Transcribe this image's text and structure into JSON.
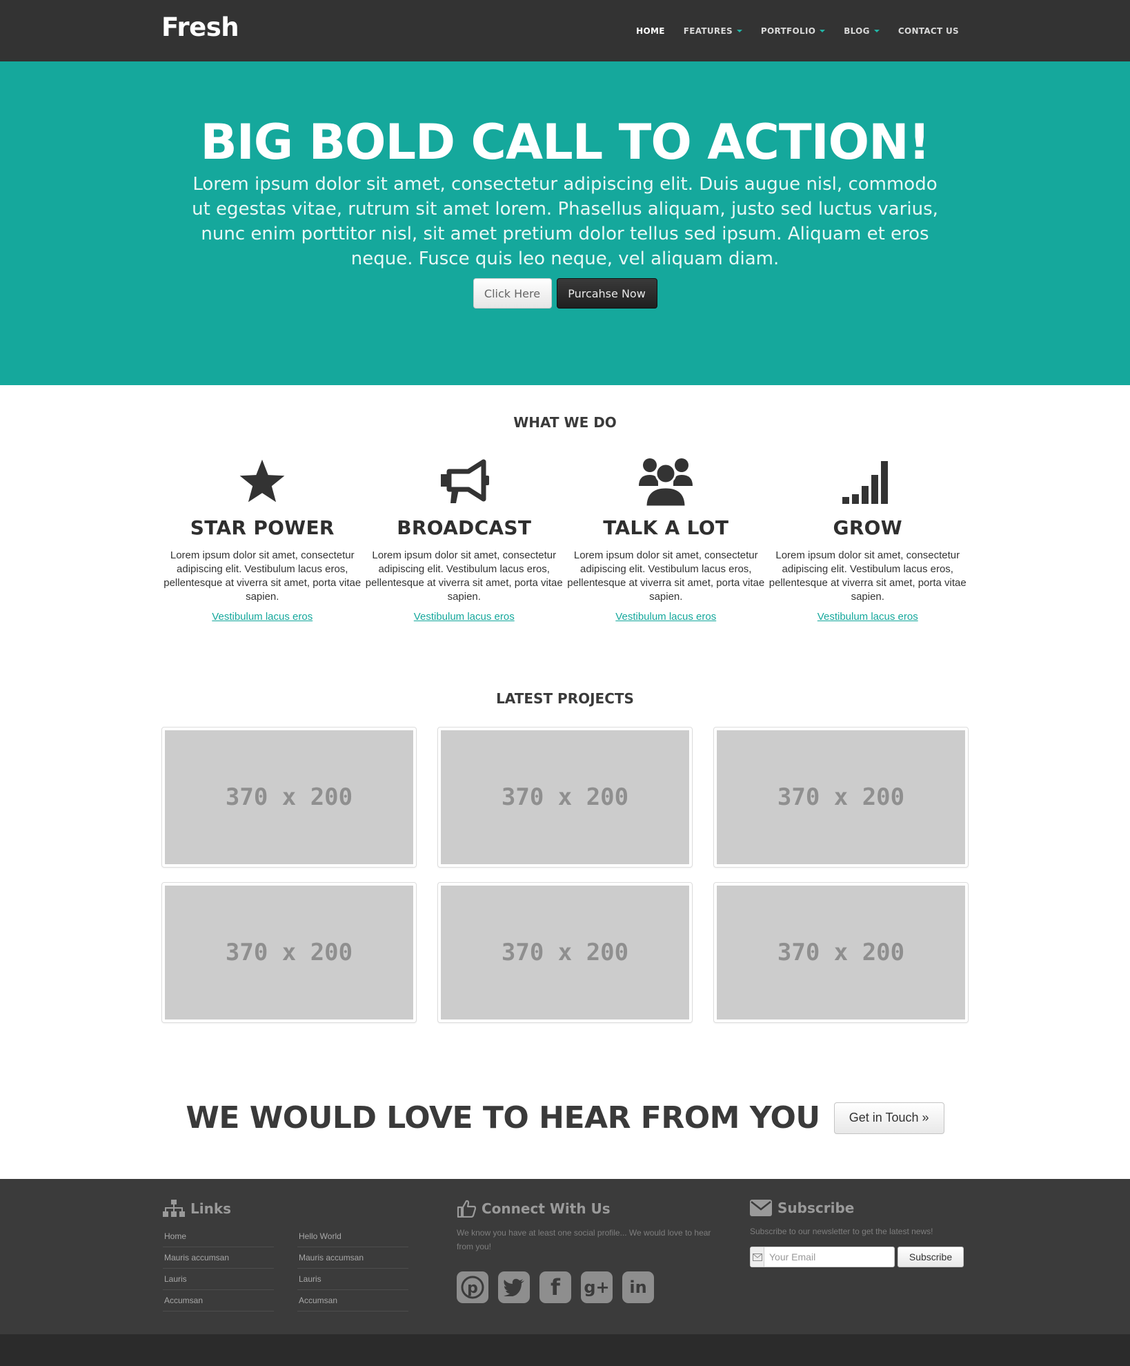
{
  "navbar": {
    "brand": "Fresh",
    "items": [
      {
        "label": "HOME",
        "active": true,
        "dropdown": false
      },
      {
        "label": "FEATURES",
        "active": false,
        "dropdown": true
      },
      {
        "label": "PORTFOLIO",
        "active": false,
        "dropdown": true
      },
      {
        "label": "BLOG",
        "active": false,
        "dropdown": true
      },
      {
        "label": "CONTACT US",
        "active": false,
        "dropdown": false
      }
    ]
  },
  "hero": {
    "title": "BIG BOLD CALL TO ACTION!",
    "text": "Lorem ipsum dolor sit amet, consectetur adipiscing elit. Duis augue nisl, commodo ut egestas vitae, rutrum sit amet lorem. Phasellus aliquam, justo sed luctus varius, nunc enim porttitor nisl, sit amet pretium dolor tellus sed ipsum. Aliquam et eros neque. Fusce quis leo neque, vel aliquam diam.",
    "button_primary": "Click Here",
    "button_secondary": "Purcahse Now"
  },
  "what_we_do": {
    "title": "WHAT WE DO",
    "features": [
      {
        "icon": "star-icon",
        "title": "STAR POWER",
        "text": "Lorem ipsum dolor sit amet, consectetur adipiscing elit. Vestibulum lacus eros, pellentesque at viverra sit amet, porta vitae sapien.",
        "link": "Vestibulum lacus eros"
      },
      {
        "icon": "megaphone-icon",
        "title": "BROADCAST",
        "text": "Lorem ipsum dolor sit amet, consectetur adipiscing elit. Vestibulum lacus eros, pellentesque at viverra sit amet, porta vitae sapien.",
        "link": "Vestibulum lacus eros"
      },
      {
        "icon": "group-icon",
        "title": "TALK A LOT",
        "text": "Lorem ipsum dolor sit amet, consectetur adipiscing elit. Vestibulum lacus eros, pellentesque at viverra sit amet, porta vitae sapien.",
        "link": "Vestibulum lacus eros"
      },
      {
        "icon": "signal-bars-icon",
        "title": "GROW",
        "text": "Lorem ipsum dolor sit amet, consectetur adipiscing elit. Vestibulum lacus eros, pellentesque at viverra sit amet, porta vitae sapien.",
        "link": "Vestibulum lacus eros"
      }
    ]
  },
  "projects": {
    "title": "LATEST PROJECTS",
    "items": [
      "370 x 200",
      "370 x 200",
      "370 x 200",
      "370 x 200",
      "370 x 200",
      "370 x 200"
    ]
  },
  "cta": {
    "title": "WE WOULD LOVE TO HEAR FROM YOU",
    "button": "Get in Touch »"
  },
  "footer": {
    "links": {
      "title": "Links",
      "icon": "sitemap-icon",
      "col1": [
        "Home",
        "Mauris accumsan",
        "Lauris",
        "Accumsan"
      ],
      "col2": [
        "Hello World",
        "Mauris accumsan",
        "Lauris",
        "Accumsan"
      ]
    },
    "connect": {
      "title": "Connect With Us",
      "icon": "thumbs-up-icon",
      "text": "We know you have at least one social profile... We would love to hear from you!",
      "social": [
        "pinterest-icon",
        "twitter-icon",
        "facebook-icon",
        "google-plus-icon",
        "linkedin-icon"
      ]
    },
    "subscribe": {
      "title": "Subscribe",
      "icon": "envelope-icon",
      "text": "Subscribe to our newsletter to get the latest news!",
      "placeholder": "Your Email",
      "button": "Subscribe"
    }
  },
  "colors": {
    "accent": "#15a89c",
    "navbar": "#333333",
    "footer": "#3b3b3b"
  }
}
